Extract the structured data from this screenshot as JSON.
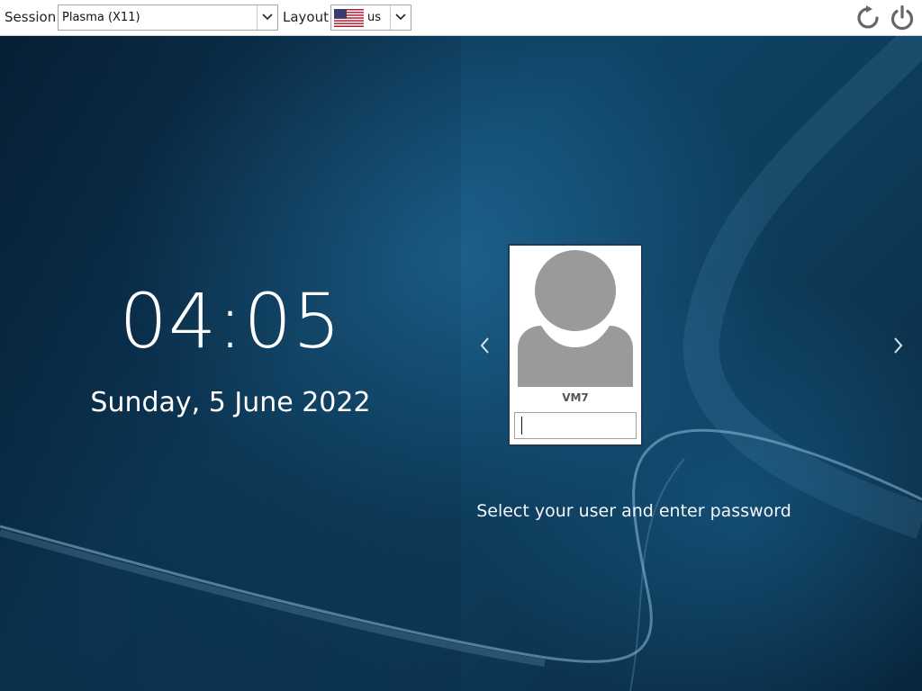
{
  "topbar": {
    "session_label": "Session",
    "session_value": "Plasma (X11)",
    "layout_label": "Layout",
    "layout_value": "us",
    "layout_flag": "us-flag-icon",
    "restart_icon": "restart-icon",
    "shutdown_icon": "power-icon"
  },
  "clock": {
    "time": "04:05",
    "date": "Sunday, 5 June 2022"
  },
  "login": {
    "user_name": "VM7",
    "password_value": "",
    "prev_icon": "chevron-left-icon",
    "next_icon": "chevron-right-icon",
    "hint": "Select your user and enter password"
  },
  "colors": {
    "background_dark": "#0b2a44",
    "background_mid": "#0f4466",
    "card_border": "#1c3c55",
    "avatar_gray": "#9a9a9a",
    "text_light": "#ffffff"
  }
}
